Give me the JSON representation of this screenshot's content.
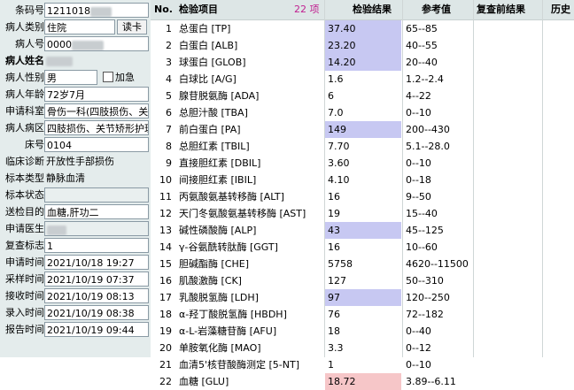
{
  "patient_form": {
    "fields": [
      {
        "label": "条码号",
        "value": "1211018",
        "blurred_width": 24,
        "bold": false
      },
      {
        "label": "病人类别",
        "value": "住院",
        "button": "读卡",
        "bold": false
      },
      {
        "label": "病人号",
        "value": "0000",
        "blurred_width": 36,
        "bold": false
      },
      {
        "label": "病人姓名",
        "value": "",
        "blurred_width": 30,
        "bold": true,
        "plain": true
      },
      {
        "label": "病人性别",
        "value": "男",
        "checkbox": "加急",
        "bold": false
      },
      {
        "label": "病人年龄",
        "value": "72岁7月",
        "bold": false
      },
      {
        "label": "申请科室",
        "value": "骨伤一科(四肢损伤、关",
        "bold": false
      },
      {
        "label": "病人病区",
        "value": "四肢损伤、关节矫形护理",
        "bold": false
      },
      {
        "label": "床号",
        "value": "0104",
        "bold": false
      },
      {
        "label": "临床诊断",
        "value": "开放性手部损伤",
        "bold": false,
        "plain": true
      },
      {
        "label": "标本类型",
        "value": "静脉血清",
        "bold": false,
        "plain": true
      },
      {
        "label": "标本状态",
        "value": "",
        "bold": false,
        "grey": true
      },
      {
        "label": "送检目的",
        "value": "血糖,肝功二",
        "bold": false
      },
      {
        "label": "申请医生",
        "value": "",
        "blurred_width": 22,
        "bold": false,
        "grey": true
      },
      {
        "label": "复查标志",
        "value": "1",
        "bold": false
      },
      {
        "label": "申请时间",
        "value": "2021/10/18 19:27",
        "bold": false
      },
      {
        "label": "采样时间",
        "value": "2021/10/19 07:37",
        "bold": false
      },
      {
        "label": "接收时间",
        "value": "2021/10/19 08:13",
        "bold": false
      },
      {
        "label": "录入时间",
        "value": "2021/10/19 08:38",
        "bold": false
      },
      {
        "label": "报告时间",
        "value": "2021/10/19 09:44",
        "bold": false
      }
    ]
  },
  "results_table": {
    "headers": {
      "no": "No.",
      "item": "检验项目",
      "count": "22 项",
      "result": "检验结果",
      "reference": "参考值",
      "recheck": "复查前结果",
      "history": "历史"
    },
    "colors": {
      "abnormal_blue": "#c7c8f2",
      "abnormal_red": "#f6c6c8",
      "count": "#c02090"
    },
    "rows": [
      {
        "no": "1",
        "item": "总蛋白 [TP]",
        "result": "37.40",
        "reference": "65--85",
        "flag": "blue"
      },
      {
        "no": "2",
        "item": "白蛋白 [ALB]",
        "result": "23.20",
        "reference": "40--55",
        "flag": "blue"
      },
      {
        "no": "3",
        "item": "球蛋白 [GLOB]",
        "result": "14.20",
        "reference": "20--40",
        "flag": "blue"
      },
      {
        "no": "4",
        "item": "白球比 [A/G]",
        "result": "1.6",
        "reference": "1.2--2.4",
        "flag": ""
      },
      {
        "no": "5",
        "item": "腺苷脱氨酶 [ADA]",
        "result": "6",
        "reference": "4--22",
        "flag": ""
      },
      {
        "no": "6",
        "item": "总胆汁酸 [TBA]",
        "result": "7.0",
        "reference": "0--10",
        "flag": ""
      },
      {
        "no": "7",
        "item": "前白蛋白 [PA]",
        "result": "149",
        "reference": "200--430",
        "flag": "blue"
      },
      {
        "no": "8",
        "item": "总胆红素 [TBIL]",
        "result": "7.70",
        "reference": "5.1--28.0",
        "flag": ""
      },
      {
        "no": "9",
        "item": "直接胆红素 [DBIL]",
        "result": "3.60",
        "reference": "0--10",
        "flag": ""
      },
      {
        "no": "10",
        "item": "间接胆红素 [IBIL]",
        "result": "4.10",
        "reference": "0--18",
        "flag": ""
      },
      {
        "no": "11",
        "item": "丙氨酸氨基转移酶 [ALT]",
        "result": "16",
        "reference": "9--50",
        "flag": ""
      },
      {
        "no": "12",
        "item": "天门冬氨酸氨基转移酶 [AST]",
        "result": "19",
        "reference": "15--40",
        "flag": ""
      },
      {
        "no": "13",
        "item": "碱性磷酸酶 [ALP]",
        "result": "43",
        "reference": "45--125",
        "flag": "blue"
      },
      {
        "no": "14",
        "item": "γ-谷氨酰转肽酶 [GGT]",
        "result": "16",
        "reference": "10--60",
        "flag": ""
      },
      {
        "no": "15",
        "item": "胆碱酯酶 [CHE]",
        "result": "5758",
        "reference": "4620--11500",
        "flag": ""
      },
      {
        "no": "16",
        "item": "肌酸激酶 [CK]",
        "result": "127",
        "reference": "50--310",
        "flag": ""
      },
      {
        "no": "17",
        "item": "乳酸脱氢酶 [LDH]",
        "result": "97",
        "reference": "120--250",
        "flag": "blue"
      },
      {
        "no": "18",
        "item": "α-羟丁酸脱氢酶 [HBDH]",
        "result": "76",
        "reference": "72--182",
        "flag": ""
      },
      {
        "no": "19",
        "item": "α-L-岩藻糖苷酶 [AFU]",
        "result": "18",
        "reference": "0--40",
        "flag": ""
      },
      {
        "no": "20",
        "item": "单胺氧化酶 [MAO]",
        "result": "3.3",
        "reference": "0--12",
        "flag": ""
      },
      {
        "no": "21",
        "item": "血清5'核苷酸酶测定 [5-NT]",
        "result": "1",
        "reference": "0--10",
        "flag": ""
      },
      {
        "no": "22",
        "item": "血糖 [GLU]",
        "result": "18.72",
        "reference": "3.89--6.11",
        "flag": "red"
      }
    ]
  }
}
